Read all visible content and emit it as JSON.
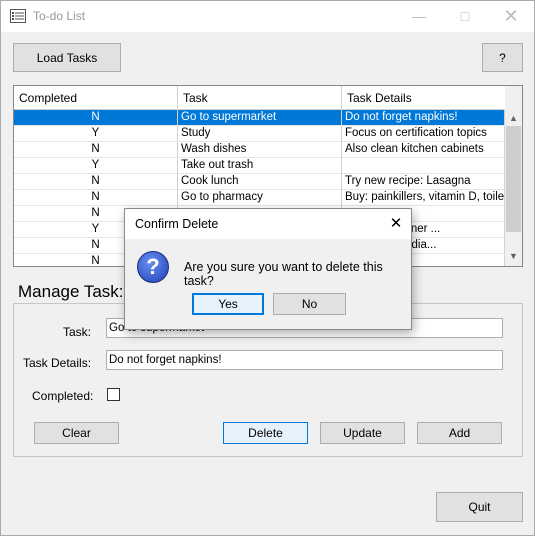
{
  "window": {
    "title": "To-do List",
    "minimize_icon": "minimize-icon",
    "maximize_icon": "maximize-icon",
    "close_icon": "close-icon"
  },
  "toolbar": {
    "load_label": "Load Tasks",
    "help_label": "?"
  },
  "table": {
    "headers": [
      "Completed",
      "Task",
      "Task Details"
    ],
    "rows": [
      {
        "completed": "N",
        "task": "Go to supermarket",
        "details": "Do not forget napkins!",
        "selected": true
      },
      {
        "completed": "Y",
        "task": "Study",
        "details": "Focus on certification topics"
      },
      {
        "completed": "N",
        "task": "Wash dishes",
        "details": "Also clean kitchen cabinets"
      },
      {
        "completed": "Y",
        "task": "Take out trash",
        "details": ""
      },
      {
        "completed": "N",
        "task": "Cook lunch",
        "details": "Try new recipe: Lasagna"
      },
      {
        "completed": "N",
        "task": "Go to pharmacy",
        "details": "Buy: painkillers, vitamin D, toile..."
      },
      {
        "completed": "N",
        "task": "",
        "details": ""
      },
      {
        "completed": "Y",
        "task": "",
        "details": "Sunday? Dinner ..."
      },
      {
        "completed": "N",
        "task": "",
        "details": "itor, agenda, dia..."
      },
      {
        "completed": "N",
        "task": "",
        "details": ""
      }
    ]
  },
  "manage": {
    "title": "Manage Task:",
    "task_label": "Task:",
    "task_value": "Go to supermarket",
    "details_label": "Task Details:",
    "details_value": "Do not forget napkins!",
    "completed_label": "Completed:",
    "clear_label": "Clear",
    "delete_label": "Delete",
    "update_label": "Update",
    "add_label": "Add"
  },
  "footer": {
    "quit_label": "Quit"
  },
  "dialog": {
    "title": "Confirm Delete",
    "message": "Are you sure you want to delete this task?",
    "icon": "question-icon",
    "yes_label": "Yes",
    "no_label": "No"
  },
  "colors": {
    "selection": "#0078d7",
    "button_bg": "#e1e1e1",
    "window_bg": "#f0f0f0"
  }
}
